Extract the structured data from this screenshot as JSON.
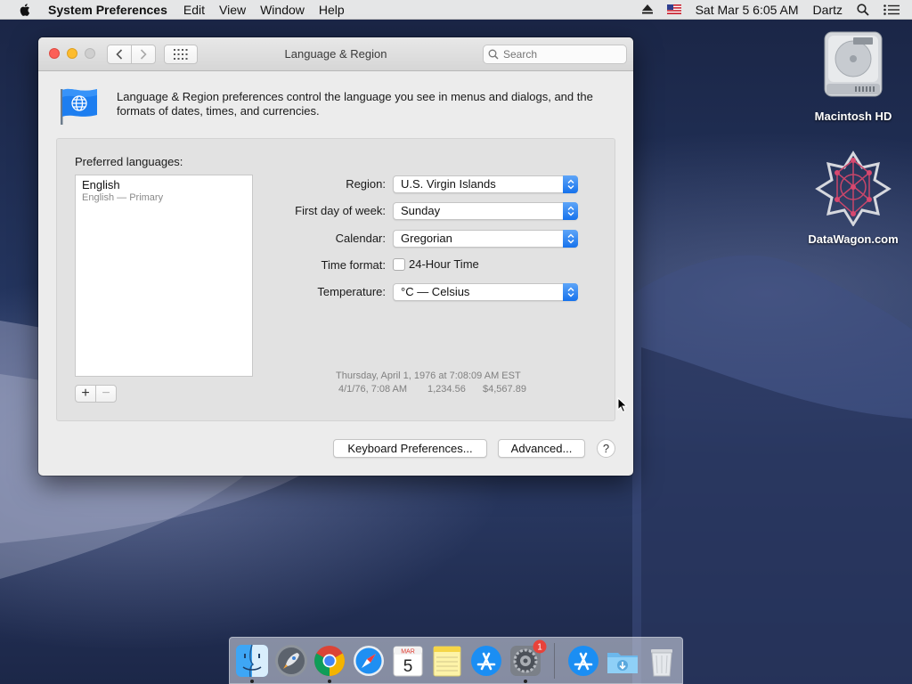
{
  "menubar": {
    "app_name": "System Preferences",
    "menus": [
      "Edit",
      "View",
      "Window",
      "Help"
    ],
    "datetime": "Sat Mar 5  6:05 AM",
    "user": "Dartz"
  },
  "window": {
    "title": "Language & Region",
    "search_placeholder": "Search"
  },
  "header": {
    "description": "Language & Region preferences control the language you see in menus and dialogs, and the formats of dates, times, and currencies."
  },
  "languages": {
    "label": "Preferred languages:",
    "items": [
      {
        "name": "English",
        "detail": "English — Primary"
      }
    ],
    "add_symbol": "+",
    "remove_symbol": "−"
  },
  "settings": {
    "region_label": "Region:",
    "region_value": "U.S. Virgin Islands",
    "first_day_label": "First day of week:",
    "first_day_value": "Sunday",
    "calendar_label": "Calendar:",
    "calendar_value": "Gregorian",
    "time_format_label": "Time format:",
    "time_format_option": "24-Hour Time",
    "time_format_checked": false,
    "temperature_label": "Temperature:",
    "temperature_value": "°C — Celsius"
  },
  "sample": {
    "long_date": "Thursday, April 1, 1976 at 7:08:09 AM EST",
    "short_date": "4/1/76, 7:08 AM",
    "number": "1,234.56",
    "currency": "$4,567.89"
  },
  "buttons": {
    "keyboard": "Keyboard Preferences...",
    "advanced": "Advanced...",
    "help": "?"
  },
  "desktop": {
    "icons": [
      {
        "label": "Macintosh HD"
      },
      {
        "label": "DataWagon.com"
      }
    ]
  },
  "dock": {
    "calendar_month": "MAR",
    "calendar_day": "5",
    "sysprefs_badge": "1"
  },
  "colors": {
    "accent": "#1672ec",
    "close": "#fc5f57",
    "minimize": "#fdbc2e",
    "badge": "#e8423a"
  }
}
